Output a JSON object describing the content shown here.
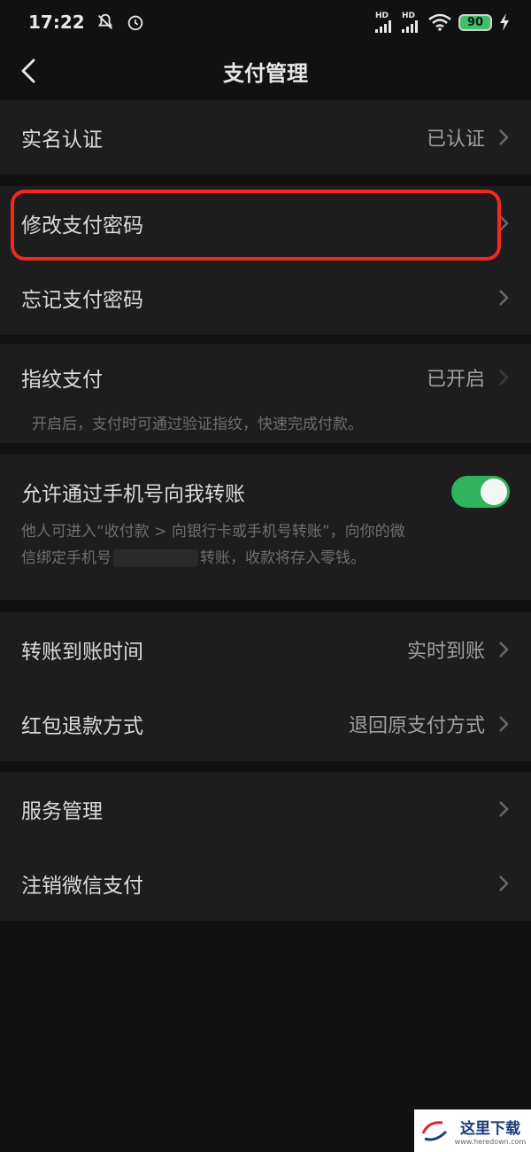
{
  "status_bar": {
    "time": "17:22",
    "signal1": "HD",
    "signal2": "HD",
    "battery": "90"
  },
  "header": {
    "title": "支付管理"
  },
  "items": {
    "real_name": {
      "label": "实名认证",
      "value": "已认证"
    },
    "change_pwd": {
      "label": "修改支付密码"
    },
    "forgot_pwd": {
      "label": "忘记支付密码"
    },
    "fingerprint": {
      "label": "指纹支付",
      "value": "已开启",
      "desc": "开启后，支付时可通过验证指纹，快速完成付款。"
    },
    "phone_transfer": {
      "label": "允许通过手机号向我转账",
      "toggle_on": true,
      "desc_line1": "他人可进入“收付款 > 向银行卡或手机号转账”，向你的微",
      "desc_line2a": "信绑定手机号",
      "desc_line2b": "转账，收款将存入零钱。"
    },
    "arrival_time": {
      "label": "转账到账时间",
      "value": "实时到账"
    },
    "refund_method": {
      "label": "红包退款方式",
      "value": "退回原支付方式"
    },
    "service_mgmt": {
      "label": "服务管理"
    },
    "cancel_pay": {
      "label": "注销微信支付"
    }
  },
  "watermark": {
    "text": "这里下载",
    "url": "www.heredown.com"
  },
  "colors": {
    "background": "#111111",
    "row_background": "#1d1d1d",
    "toggle_green": "#2fb35c",
    "highlight_red": "#f02a1f"
  }
}
